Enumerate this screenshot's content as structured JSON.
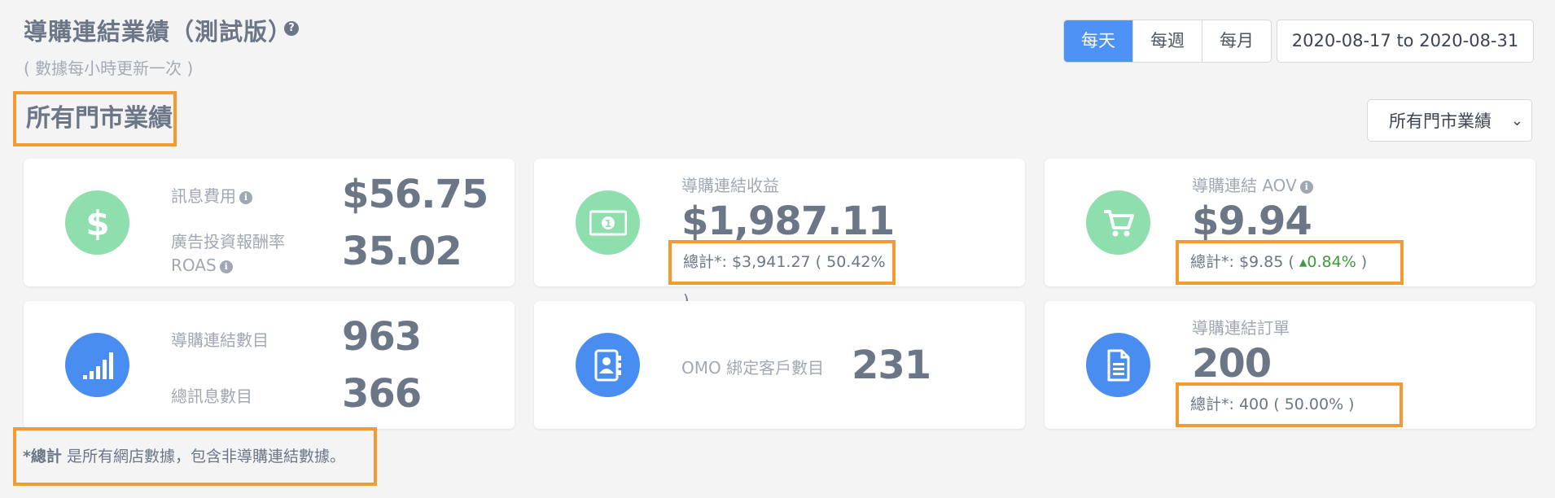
{
  "header": {
    "title": "導購連結業績（測試版）",
    "help_glyph": "?",
    "subtitle": "( 數據每小時更新一次 )"
  },
  "date_range": {
    "buttons": [
      {
        "label": "每天",
        "active": true
      },
      {
        "label": "每週",
        "active": false
      },
      {
        "label": "每月",
        "active": false
      }
    ],
    "value": "2020-08-17 to 2020-08-31"
  },
  "section": {
    "title": "所有門市業績",
    "select_value": "所有門市業績"
  },
  "cards": {
    "message_cost": {
      "label": "訊息費用",
      "value": "$56.75",
      "icon": "dollar-icon"
    },
    "roas": {
      "label_line1": "廣告投資報酬率",
      "label_line2": "ROAS",
      "value": "35.02"
    },
    "revenue": {
      "label": "導購連結收益",
      "value": "$1,987.11",
      "total": "總計*: $3,941.27 ( 50.42% )",
      "icon": "money-bill-icon"
    },
    "aov": {
      "label": "導購連結 AOV",
      "value": "$9.94",
      "total_prefix": "總計*: $9.85 (",
      "change": "0.84%",
      "total_suffix": ")",
      "icon": "shopping-cart-icon"
    },
    "link_count": {
      "label": "導購連結數目",
      "value": "963",
      "icon": "signal-bars-icon"
    },
    "message_count": {
      "label": "總訊息數目",
      "value": "366"
    },
    "omo": {
      "label": "OMO 綁定客戶數目",
      "value": "231",
      "icon": "address-book-icon"
    },
    "orders": {
      "label": "導購連結訂單",
      "value": "200",
      "total": "總計*: 400 ( 50.00% )",
      "icon": "document-icon"
    }
  },
  "footnote": {
    "bold": "*總計",
    "text": " 是所有網店數據，包含非導購連結數據。"
  },
  "colors": {
    "accent": "#4f92f5",
    "green_icon": "#8fdeae",
    "blue_icon": "#4a8df0",
    "highlight": "#f39a33",
    "up": "#3d9a3d"
  }
}
